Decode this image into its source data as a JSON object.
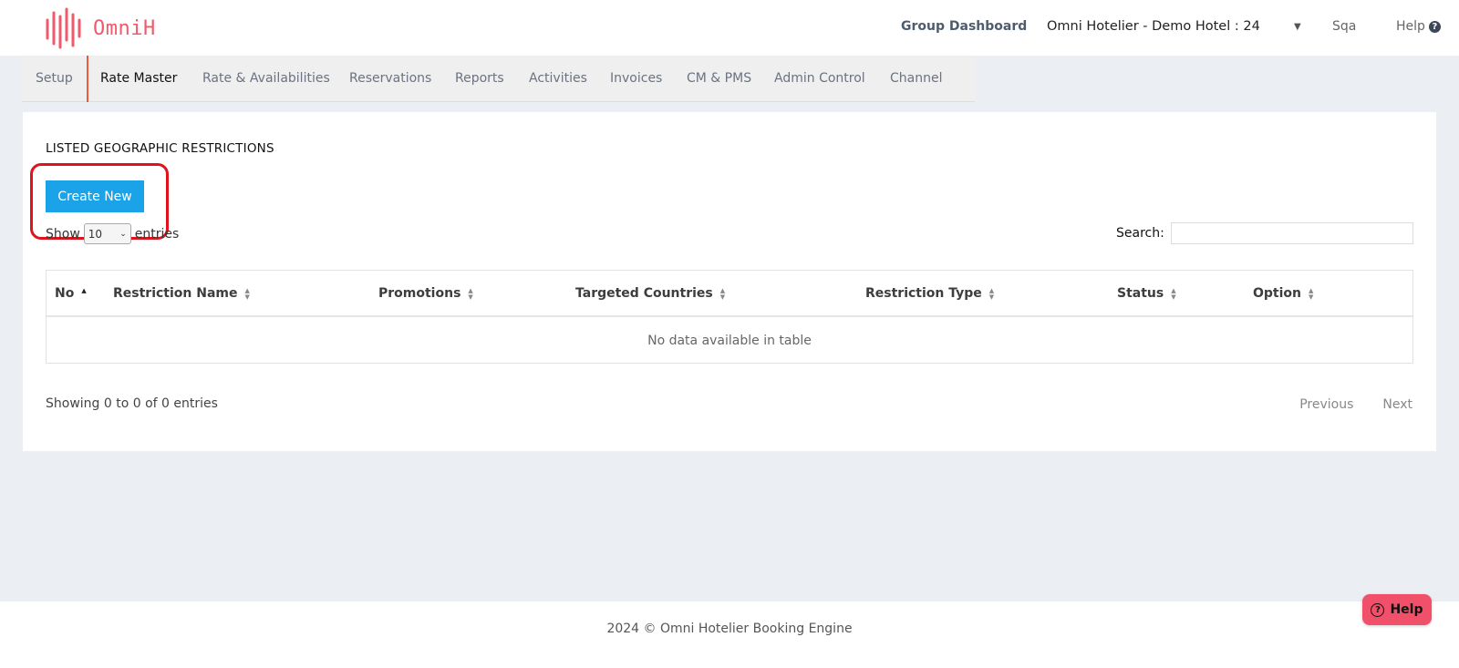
{
  "header": {
    "logo_text": "OmniH",
    "group_dashboard": "Group Dashboard",
    "hotel_selector": "Omni Hotelier - Demo Hotel : 24",
    "user": "Sqa",
    "help": "Help"
  },
  "nav": {
    "items": [
      {
        "label": "Setup"
      },
      {
        "label": "Rate Master"
      },
      {
        "label": "Rate & Availabilities"
      },
      {
        "label": "Reservations"
      },
      {
        "label": "Reports"
      },
      {
        "label": "Activities"
      },
      {
        "label": "Invoices"
      },
      {
        "label": "CM & PMS"
      },
      {
        "label": "Admin Control"
      },
      {
        "label": "Channel"
      }
    ],
    "active": "Rate Master"
  },
  "main": {
    "title": "LISTED GEOGRAPHIC RESTRICTIONS",
    "create_button": "Create New",
    "show_label": "Show",
    "entries_label": "entries",
    "page_size": "10",
    "search_label": "Search:",
    "search_value": "",
    "table": {
      "columns": [
        "No",
        "Restriction Name",
        "Promotions",
        "Targeted Countries",
        "Restriction Type",
        "Status",
        "Option"
      ],
      "empty_message": "No data available in table"
    },
    "info": "Showing 0 to 0 of 0 entries",
    "pager": {
      "previous": "Previous",
      "next": "Next"
    }
  },
  "footer": {
    "text": "2024 © Omni Hotelier Booking Engine"
  },
  "help_widget": {
    "label": "Help"
  },
  "colors": {
    "brand": "#f05a6a",
    "primary_button": "#1aa3e8",
    "highlight": "#e0121b"
  }
}
